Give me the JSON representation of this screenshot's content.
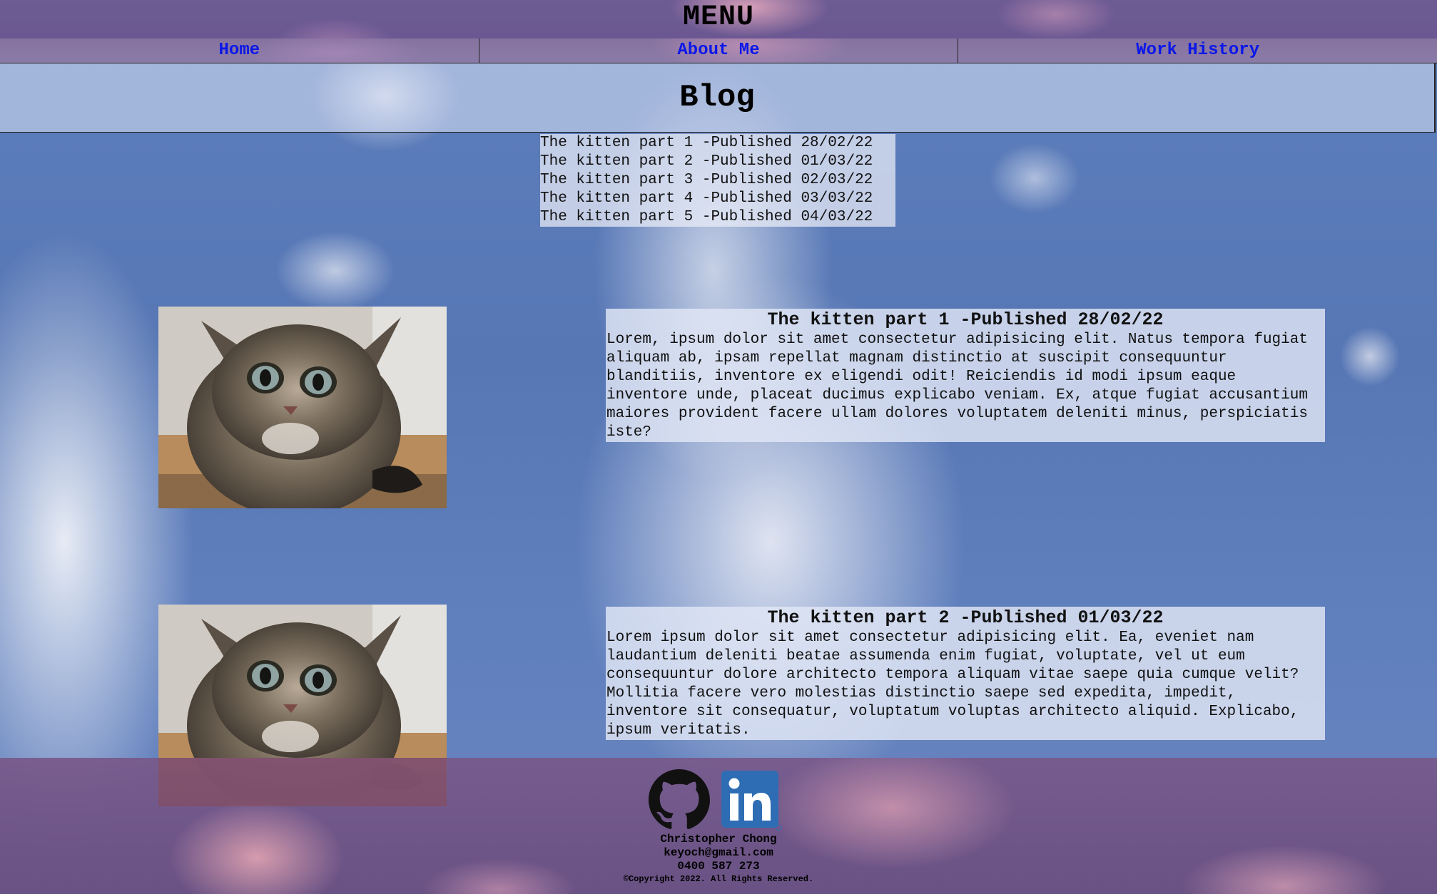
{
  "header": {
    "title": "MENU"
  },
  "nav": {
    "items": [
      {
        "label": "Home"
      },
      {
        "label": "About Me"
      },
      {
        "label": "Work History"
      }
    ]
  },
  "blog": {
    "title": "Blog",
    "index": [
      "The kitten part 1 -Published 28/02/22",
      "The kitten part 2 -Published 01/03/22",
      "The kitten part 3 -Published 02/03/22",
      "The kitten part 4 -Published 03/03/22",
      "The kitten part 5 -Published 04/03/22"
    ],
    "posts": [
      {
        "title": "The kitten part 1 -Published 28/02/22",
        "body": "Lorem, ipsum dolor sit amet consectetur adipisicing elit. Natus tempora fugiat aliquam ab, ipsam repellat magnam distinctio at suscipit consequuntur blanditiis, inventore ex eligendi odit! Reiciendis id modi ipsum eaque inventore unde, placeat ducimus explicabo veniam. Ex, atque fugiat accusantium maiores provident facere ullam dolores voluptatem deleniti minus, perspiciatis iste?"
      },
      {
        "title": "The kitten part 2 -Published 01/03/22",
        "body": "Lorem ipsum dolor sit amet consectetur adipisicing elit. Ea, eveniet nam laudantium deleniti beatae assumenda enim fugiat, voluptate, vel ut eum consequuntur dolore architecto tempora aliquam vitae saepe quia cumque velit? Mollitia facere vero molestias distinctio saepe sed expedita, impedit, inventore sit consequatur, voluptatum voluptas architecto aliquid. Explicabo, ipsum veritatis."
      }
    ]
  },
  "footer": {
    "icons": [
      "github-icon",
      "linkedin-icon"
    ],
    "name": "Christopher Chong",
    "email": "keyoch@gmail.com",
    "phone": "0400 587 273",
    "copyright": "©Copyright 2022. All Rights Reserved."
  },
  "colors": {
    "nav_link": "#0b17e8",
    "header_purple": "#6d5b93",
    "sky_blue": "#5e7fbd",
    "linkedin_blue": "#2e6db4"
  }
}
